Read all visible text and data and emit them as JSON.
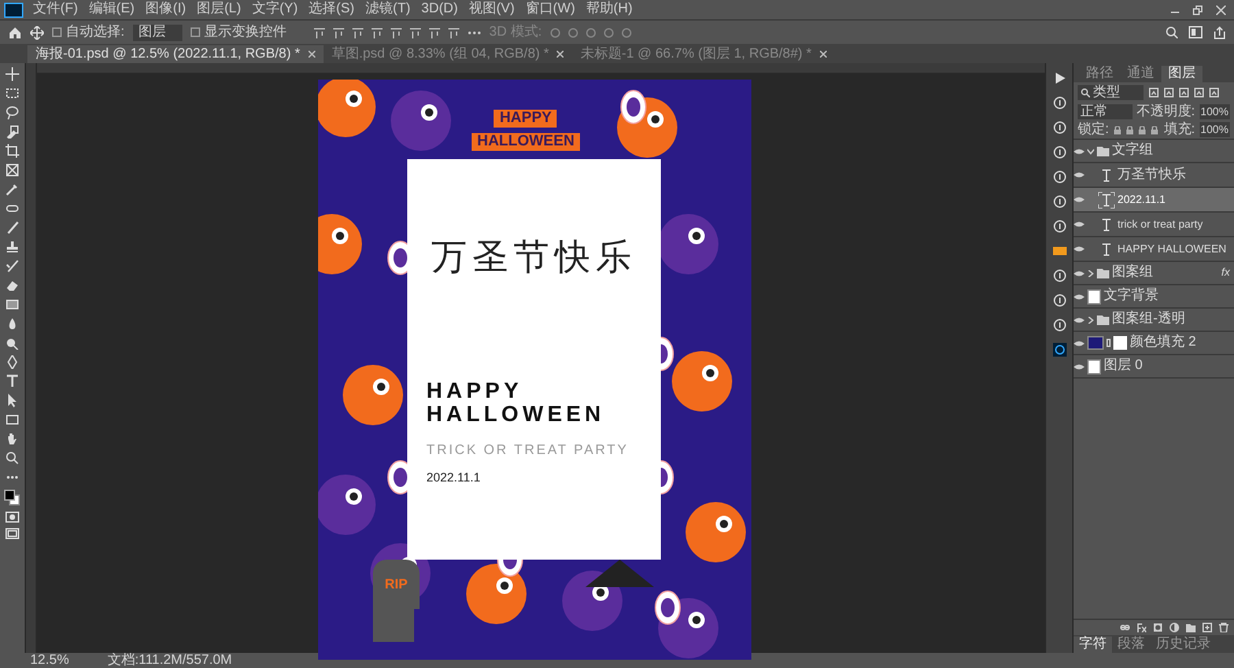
{
  "menu_bar": {
    "items": [
      "文件(F)",
      "编辑(E)",
      "图像(I)",
      "图层(L)",
      "文字(Y)",
      "选择(S)",
      "滤镜(T)",
      "3D(D)",
      "视图(V)",
      "窗口(W)",
      "帮助(H)"
    ]
  },
  "options_bar": {
    "auto_select": {
      "label": "自动选择:",
      "checked": false
    },
    "target": {
      "value": "图层"
    },
    "transform_controls": {
      "label": "显示变换控件",
      "checked": false
    },
    "mode_3d": "3D 模式:"
  },
  "document_tabs": [
    {
      "label": "海报-01.psd @ 12.5% (2022.11.1, RGB/8) *",
      "selected": true
    },
    {
      "label": "草图.psd @ 8.33% (组 04, RGB/8) *",
      "selected": false
    },
    {
      "label": "未标题-1 @ 66.7% (图层 1, RGB/8#) *",
      "selected": false
    }
  ],
  "poster": {
    "banner": [
      "HAPPY",
      "HALLOWEEN"
    ],
    "title": "万圣节快乐",
    "headline": [
      "HAPPY",
      "HALLOWEEN"
    ],
    "subtitle": "TRICK OR TREAT PARTY",
    "date": "2022.11.1",
    "tombstone": "RIP"
  },
  "panel_tabs": [
    {
      "label": "路径",
      "selected": false
    },
    {
      "label": "通道",
      "selected": false
    },
    {
      "label": "图层",
      "selected": true
    }
  ],
  "layers_panel": {
    "filter": "类型",
    "blend_mode": "正常",
    "opacity_label": "不透明度:",
    "opacity": "100%",
    "lock_label": "锁定:",
    "fill_label": "填充:",
    "fill": "100%",
    "layers": [
      {
        "kind": "group",
        "name": "文字组",
        "expanded": true,
        "selected": false,
        "children": [
          {
            "kind": "text",
            "name": "万圣节快乐",
            "selected": false
          },
          {
            "kind": "text",
            "name": "2022.11.1",
            "selected": true
          },
          {
            "kind": "text",
            "name": "trick or treat party",
            "selected": false
          },
          {
            "kind": "text",
            "name": "HAPPY HALLOWEEN",
            "selected": false
          }
        ]
      },
      {
        "kind": "group",
        "name": "图案组",
        "expanded": false,
        "selected": false,
        "fx": "fx"
      },
      {
        "kind": "image",
        "name": "文字背景",
        "selected": false
      },
      {
        "kind": "group",
        "name": "图案组-透明",
        "expanded": false,
        "selected": false
      },
      {
        "kind": "fill",
        "name": "颜色填充 2",
        "selected": false,
        "color": "#1e1a78"
      },
      {
        "kind": "image",
        "name": "图层 0",
        "selected": false
      }
    ]
  },
  "bottom_tabs": [
    {
      "label": "字符",
      "selected": true
    },
    {
      "label": "段落",
      "selected": false
    },
    {
      "label": "历史记录",
      "selected": false
    }
  ],
  "status_bar": {
    "zoom": "12.5%",
    "doc_size": "文档:111.2M/557.0M"
  }
}
